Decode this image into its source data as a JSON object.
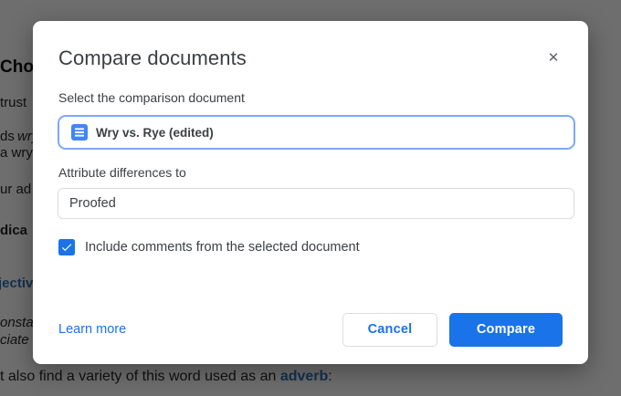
{
  "dialog": {
    "title": "Compare documents",
    "close_icon_glyph": "✕",
    "select_document": {
      "label": "Select the comparison document",
      "value": "Wry vs. Rye (edited)"
    },
    "attribute": {
      "label": "Attribute differences to",
      "value": "Proofed"
    },
    "include_comments": {
      "label": "Include comments from the selected document",
      "checked": true
    },
    "learn_more_label": "Learn more",
    "cancel_label": "Cancel",
    "compare_label": "Compare"
  },
  "colors": {
    "primary_blue": "#1a73e8",
    "docs_icon_blue": "#4285f4",
    "selector_focus_border": "#7baaf7",
    "input_border": "#dadce0",
    "background_emphasis_blue": "#2e75b6"
  },
  "background_document": {
    "fragments": [
      {
        "text": "Cho"
      },
      {
        "text": "trust"
      },
      {
        "text": "ds "
      },
      {
        "text": "wry"
      },
      {
        "text": "a wry"
      },
      {
        "text": "ur ad"
      },
      {
        "text": "dica"
      },
      {
        "text": "jectiv"
      },
      {
        "text": "onsta"
      },
      {
        "text": "ciate"
      }
    ],
    "bottom_line": {
      "prefix": "t also find a variety of this word used as an ",
      "emphasis": "adverb",
      "suffix": ":"
    }
  }
}
